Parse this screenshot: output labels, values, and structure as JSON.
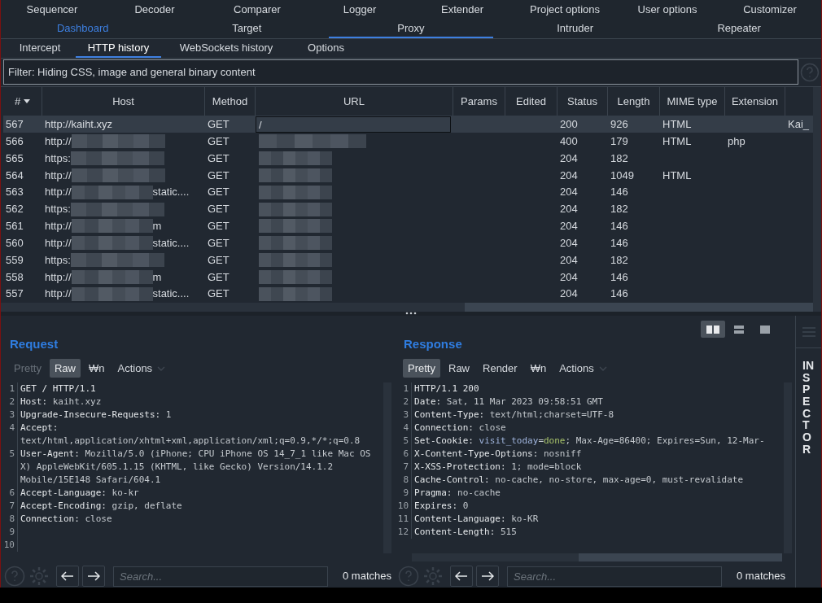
{
  "tool_tabs_row1": [
    {
      "label": "Sequencer",
      "selected": false
    },
    {
      "label": "Decoder",
      "selected": false
    },
    {
      "label": "Comparer",
      "selected": false
    },
    {
      "label": "Logger",
      "selected": false
    },
    {
      "label": "Extender",
      "selected": false
    },
    {
      "label": "Project options",
      "selected": false
    },
    {
      "label": "User options",
      "selected": false
    },
    {
      "label": "Customizer",
      "selected": false
    }
  ],
  "tool_tabs_row2": [
    {
      "label": "Dashboard",
      "selected": false,
      "highlighted": true
    },
    {
      "label": "Target",
      "selected": false,
      "highlighted": false
    },
    {
      "label": "Proxy",
      "selected": true,
      "highlighted": false
    },
    {
      "label": "Intruder",
      "selected": false,
      "highlighted": false
    },
    {
      "label": "Repeater",
      "selected": false,
      "highlighted": false
    }
  ],
  "proxy_tabs": [
    {
      "label": "Intercept",
      "selected": false
    },
    {
      "label": "HTTP history",
      "selected": true
    },
    {
      "label": "WebSockets history",
      "selected": false
    },
    {
      "label": "Options",
      "selected": false
    }
  ],
  "filter": {
    "text": "Filter: Hiding CSS, image and general binary content"
  },
  "table": {
    "columns": [
      "#",
      "Host",
      "Method",
      "URL",
      "Params",
      "Edited",
      "Status",
      "Length",
      "MIME type",
      "Extension"
    ],
    "rows": [
      {
        "number": "567",
        "host": {
          "prefix": "http://kaiht.xyz",
          "redacted": false
        },
        "method": "GET",
        "url": {
          "text": "/",
          "redacted": false
        },
        "status": "200",
        "length": "926",
        "mime": "HTML",
        "column_11": "Kai_",
        "selected": true
      },
      {
        "number": "566",
        "host": {
          "prefix": "http://",
          "redacted": true
        },
        "method": "GET",
        "url": {
          "redacted": true
        },
        "status": "400",
        "length": "179",
        "mime": "HTML",
        "extension": "php",
        "selected": false
      },
      {
        "number": "565",
        "host": {
          "prefix": "https:",
          "redacted": true
        },
        "method": "GET",
        "url": {
          "redacted": true
        },
        "status": "204",
        "length": "182",
        "selected": false
      },
      {
        "number": "564",
        "host": {
          "prefix": "http://",
          "redacted": true
        },
        "method": "GET",
        "url": {
          "redacted": true
        },
        "status": "204",
        "length": "1049",
        "mime": "HTML",
        "selected": false
      },
      {
        "number": "563",
        "host": {
          "prefix": "http://",
          "redacted": true,
          "suffix": "static...."
        },
        "method": "GET",
        "url": {
          "redacted": true
        },
        "status": "204",
        "length": "146",
        "selected": false
      },
      {
        "number": "562",
        "host": {
          "prefix": "https:",
          "redacted": true
        },
        "method": "GET",
        "url": {
          "redacted": true
        },
        "status": "204",
        "length": "182",
        "selected": false
      },
      {
        "number": "561",
        "host": {
          "prefix": "http://",
          "redacted": true,
          "suffix": "m"
        },
        "method": "GET",
        "url": {
          "redacted": true
        },
        "status": "204",
        "length": "146",
        "selected": false
      },
      {
        "number": "560",
        "host": {
          "prefix": "http://",
          "redacted": true,
          "suffix": "static...."
        },
        "method": "GET",
        "url": {
          "redacted": true
        },
        "status": "204",
        "length": "146",
        "selected": false
      },
      {
        "number": "559",
        "host": {
          "prefix": "https:",
          "redacted": true
        },
        "method": "GET",
        "url": {
          "redacted": true
        },
        "status": "204",
        "length": "182",
        "selected": false
      },
      {
        "number": "558",
        "host": {
          "prefix": "http://",
          "redacted": true,
          "suffix": "m"
        },
        "method": "GET",
        "url": {
          "redacted": true
        },
        "status": "204",
        "length": "146",
        "selected": false
      },
      {
        "number": "557",
        "host": {
          "prefix": "http://",
          "redacted": true,
          "suffix": "static...."
        },
        "method": "GET",
        "url": {
          "redacted": true
        },
        "status": "204",
        "length": "146",
        "selected": false
      }
    ]
  },
  "request": {
    "title": "Request",
    "view_tabs": [
      {
        "label": "Pretty",
        "selected": false,
        "disabled": true
      },
      {
        "label": "Raw",
        "selected": true,
        "disabled": false
      },
      {
        "label": "₩n",
        "selected": false,
        "disabled": false
      }
    ],
    "actions": "Actions",
    "lines": [
      {
        "number": "1",
        "parts": [
          {
            "kind": "name",
            "text": "GET / HTTP/1.1"
          }
        ]
      },
      {
        "number": "2",
        "parts": [
          {
            "kind": "name",
            "text": "Host:"
          },
          {
            "kind": "value",
            "text": " kaiht.xyz"
          }
        ]
      },
      {
        "number": "3",
        "parts": [
          {
            "kind": "name",
            "text": "Upgrade-Insecure-Requests:"
          },
          {
            "kind": "value",
            "text": " 1"
          }
        ]
      },
      {
        "number": "4",
        "parts": [
          {
            "kind": "name",
            "text": "Accept:"
          },
          {
            "kind": "value",
            "text": " text/html,application/xhtml+xml,application/xml;q=0.9,*/*;q=0.8"
          }
        ]
      },
      {
        "number": "5",
        "parts": [
          {
            "kind": "name",
            "text": "User-Agent:"
          },
          {
            "kind": "value",
            "text": " Mozilla/5.0 (iPhone; CPU iPhone OS 14_7_1 like Mac OS X) AppleWebKit/605.1.15 (KHTML, like Gecko) Version/14.1.2 Mobile/15E148 Safari/604.1"
          }
        ]
      },
      {
        "number": "6",
        "parts": [
          {
            "kind": "name",
            "text": "Accept-Language:"
          },
          {
            "kind": "value",
            "text": " ko-kr"
          }
        ]
      },
      {
        "number": "7",
        "parts": [
          {
            "kind": "name",
            "text": "Accept-Encoding:"
          },
          {
            "kind": "value",
            "text": " gzip, deflate"
          }
        ]
      },
      {
        "number": "8",
        "parts": [
          {
            "kind": "name",
            "text": "Connection:"
          },
          {
            "kind": "value",
            "text": " close"
          }
        ]
      },
      {
        "number": "9"
      },
      {
        "number": "10"
      }
    ],
    "search": {
      "placeholder": "Search..."
    },
    "matches": "0 matches"
  },
  "response": {
    "title": "Response",
    "view_tabs": [
      {
        "label": "Pretty",
        "selected": true,
        "disabled": false
      },
      {
        "label": "Raw",
        "selected": false,
        "disabled": false
      },
      {
        "label": "Render",
        "selected": false,
        "disabled": false
      },
      {
        "label": "₩n",
        "selected": false,
        "disabled": false
      }
    ],
    "actions": "Actions",
    "lines": [
      {
        "number": "1",
        "parts": [
          {
            "kind": "name",
            "text": "HTTP/1.1 200"
          }
        ]
      },
      {
        "number": "2",
        "parts": [
          {
            "kind": "name",
            "text": "Date:"
          },
          {
            "kind": "value",
            "text": " Sat, 11 Mar 2023 09:58:51 GMT"
          }
        ]
      },
      {
        "number": "3",
        "parts": [
          {
            "kind": "name",
            "text": "Content-Type:"
          },
          {
            "kind": "value",
            "text": " text/html;charset=UTF-8"
          }
        ]
      },
      {
        "number": "4",
        "parts": [
          {
            "kind": "name",
            "text": "Connection:"
          },
          {
            "kind": "value",
            "text": " close"
          }
        ]
      },
      {
        "number": "5",
        "parts": [
          {
            "kind": "name",
            "text": "Set-Cookie: "
          },
          {
            "kind": "cookie_name",
            "text": "visit_today"
          },
          {
            "kind": "value",
            "text": "="
          },
          {
            "kind": "cookie_value",
            "text": "done"
          },
          {
            "kind": "value",
            "text": "; Max-Age=86400; Expires=Sun, 12-Mar-"
          }
        ]
      },
      {
        "number": "6",
        "parts": [
          {
            "kind": "name",
            "text": "X-Content-Type-Options:"
          },
          {
            "kind": "value",
            "text": " nosniff"
          }
        ]
      },
      {
        "number": "7",
        "parts": [
          {
            "kind": "name",
            "text": "X-XSS-Protection:"
          },
          {
            "kind": "value",
            "text": " 1; mode=block"
          }
        ]
      },
      {
        "number": "8",
        "parts": [
          {
            "kind": "name",
            "text": "Cache-Control:"
          },
          {
            "kind": "value",
            "text": " no-cache, no-store, max-age=0, must-revalidate"
          }
        ]
      },
      {
        "number": "9",
        "parts": [
          {
            "kind": "name",
            "text": "Pragma:"
          },
          {
            "kind": "value",
            "text": " no-cache"
          }
        ]
      },
      {
        "number": "10",
        "parts": [
          {
            "kind": "name",
            "text": "Expires:"
          },
          {
            "kind": "value",
            "text": " 0"
          }
        ]
      },
      {
        "number": "11",
        "parts": [
          {
            "kind": "name",
            "text": "Content-Language:"
          },
          {
            "kind": "value",
            "text": " ko-KR"
          }
        ]
      },
      {
        "number": "12",
        "parts": [
          {
            "kind": "name",
            "text": "Content-Length:"
          },
          {
            "kind": "value",
            "text": " 515"
          }
        ]
      }
    ],
    "search": {
      "placeholder": "Search..."
    },
    "matches": "0 matches"
  },
  "layout_buttons": [
    {
      "kind": "split",
      "selected": true
    },
    {
      "kind": "stacked",
      "selected": false
    },
    {
      "kind": "single",
      "selected": false
    }
  ],
  "inspector": {
    "label": "INSPECTOR"
  }
}
